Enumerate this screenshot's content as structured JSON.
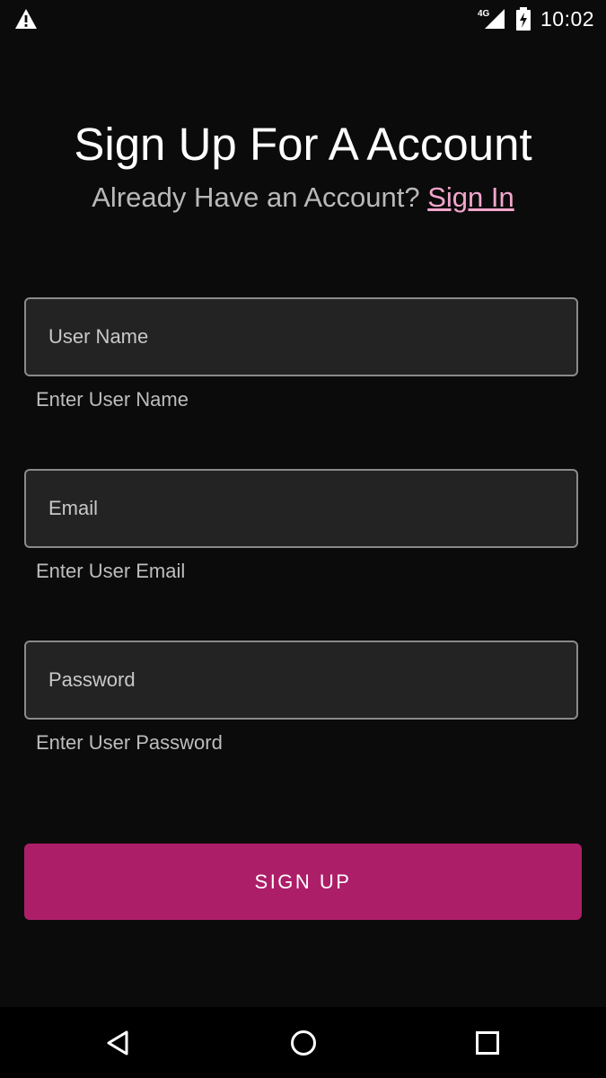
{
  "status_bar": {
    "time": "10:02",
    "network": "4G",
    "icons": [
      "warning-icon",
      "signal-icon",
      "battery-charging-icon"
    ]
  },
  "header": {
    "title": "Sign Up For A Account",
    "prompt": "Already Have an Account?",
    "signin_link": "Sign In"
  },
  "form": {
    "fields": [
      {
        "placeholder": "User Name",
        "value": "",
        "helper": "Enter User Name"
      },
      {
        "placeholder": "Email",
        "value": "",
        "helper": "Enter User Email"
      },
      {
        "placeholder": "Password",
        "value": "",
        "helper": "Enter User Password"
      }
    ],
    "submit_label": "SIGN UP"
  },
  "nav_bar": {
    "icons": [
      "back-icon",
      "home-icon",
      "recents-icon"
    ]
  },
  "colors": {
    "background": "#0b0b0b",
    "accent": "#ad1e68",
    "link": "#f2a6cd",
    "field_bg": "#232323",
    "field_border": "#8a8a8a"
  }
}
